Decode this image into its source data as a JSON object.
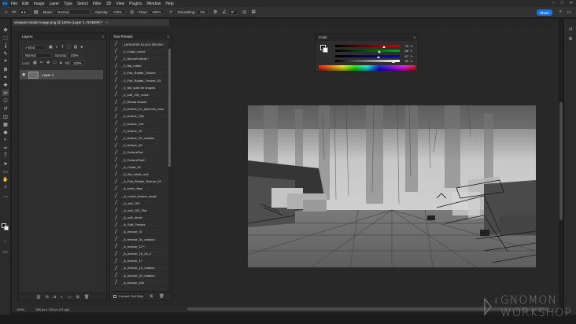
{
  "menubar": {
    "logo": "Ps",
    "items": [
      "File",
      "Edit",
      "Image",
      "Layer",
      "Type",
      "Select",
      "Filter",
      "3D",
      "View",
      "Plugins",
      "Window",
      "Help"
    ],
    "window_controls": [
      "–",
      "□",
      "✕"
    ]
  },
  "options": {
    "mode_label": "Mode:",
    "mode_value": "Normal",
    "opacity_label": "Opacity:",
    "opacity_value": "100%",
    "flow_label": "Flow:",
    "flow_value": "100%",
    "smoothing_label": "Smoothing:",
    "smoothing_value": "0%",
    "angle_value": "0°",
    "share_label": "Share"
  },
  "document": {
    "tab_title": "viewport render image.png @ 100% (Layer 1, RGB/8#) *",
    "tab_close": "×"
  },
  "layers": {
    "title": "Layers",
    "filter_value": "Kind",
    "blend_value": "Normal",
    "opacity_label": "Opacity:",
    "opacity_value": "100%",
    "lock_label": "Lock:",
    "fill_label": "Fill:",
    "fill_value": "100%",
    "layer_name": "Layer 1"
  },
  "presets": {
    "title": "Tool Presets",
    "items": [
      "_JAPANESE BLACK BRUSH",
      "_0_Chalk_round",
      "_0_flat soft streak *",
      "_0_flat_rotate",
      "_0_Flat_Rotate_Texture",
      "_0_Flat_Rotate_Texture_03",
      "_0_flat_solid for shapes",
      "_0_soft_100_noise",
      "_0_Streak texture",
      "_0_texture_01_dynamic_color",
      "_0_texture_15b",
      "_0_texture_15c",
      "_0_texture_35",
      "_0_texture_35_rotation",
      "_0_texture_38",
      "_0_TextureFlat",
      "_0_TextureFlat2",
      "_A_Chalk_01",
      "_A_flat_rotate_soft",
      "_A_Flat_Rotate_Texture_02",
      "_A_hard_draw",
      "_A_round_texture_small",
      "_A_soft_100",
      "_A_soft_100_Flat",
      "_A_soft_brush",
      "_A_Soft_Texture",
      "_A_texture_01",
      "_A_texture_04_rotation",
      "_A_texture_11**",
      "_A_texture_15_2b_2",
      "_A_texture_17",
      "_A_texture_19_rotation",
      "_A_texture_20_rotation",
      "_A_texture_22b"
    ],
    "current_tool_only": "Current Tool Only"
  },
  "color": {
    "title": "Color",
    "channels": [
      {
        "value": "75",
        "level": 0.75,
        "gradient": "linear-gradient(to right,#000,#c00)"
      },
      {
        "value": "68",
        "level": 0.68,
        "gradient": "linear-gradient(to right,#000,#0a0)"
      },
      {
        "value": "67",
        "level": 0.67,
        "gradient": "linear-gradient(to right,#000,#00c)"
      },
      {
        "value": "90",
        "level": 0.9,
        "gradient": "linear-gradient(to right,#000,#fff)"
      }
    ],
    "unit": "%"
  },
  "status": {
    "zoom": "100%",
    "info": "366 px x 206 px (72 ppi)"
  },
  "watermark": {
    "the": "THE",
    "line1": "GNOMON",
    "line2": "WORKSHOP"
  },
  "icons": {
    "move": "✥",
    "marquee": "⬚",
    "lasso": "ʆ",
    "quick_select": "✎",
    "crop": "⌗",
    "frame": "⊠",
    "eyedropper": "✒",
    "heal": "✚",
    "brush": "✏",
    "stamp": "⎔",
    "history": "↺",
    "eraser": "◫",
    "gradient": "▦",
    "blur": "◉",
    "dodge": "◐",
    "pen": "✑",
    "type": "T",
    "path_select": "➤",
    "shape": "▭",
    "hand": "✋",
    "zoom": "⌕",
    "dots": "⋯"
  }
}
